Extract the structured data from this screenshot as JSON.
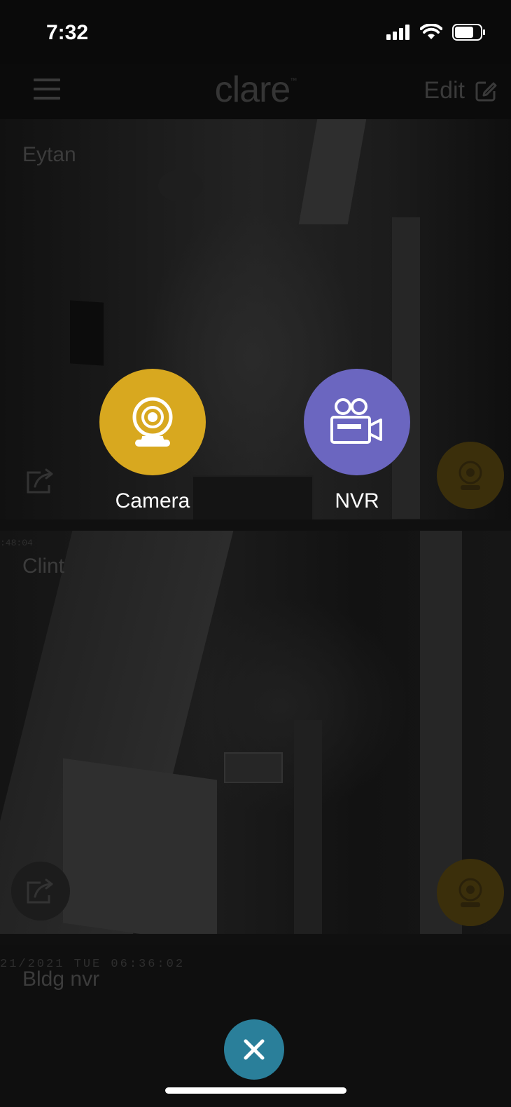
{
  "status_bar": {
    "time": "7:32"
  },
  "header": {
    "logo": "clare",
    "logo_tm": "™",
    "edit_label": "Edit"
  },
  "tiles": [
    {
      "name": "Eytan"
    },
    {
      "name": "Clint",
      "overlay_timestamp": ":48:04"
    },
    {
      "name": "Bldg nvr",
      "overlay_timestamp": "21/2021 TUE 06:36:02"
    }
  ],
  "add_menu": {
    "options": [
      {
        "label": "Camera",
        "color": "#d8a81f",
        "icon": "webcam-icon"
      },
      {
        "label": "NVR",
        "color": "#6b66c0",
        "icon": "video-camera-icon"
      }
    ],
    "close_color": "#2a7f9a"
  }
}
